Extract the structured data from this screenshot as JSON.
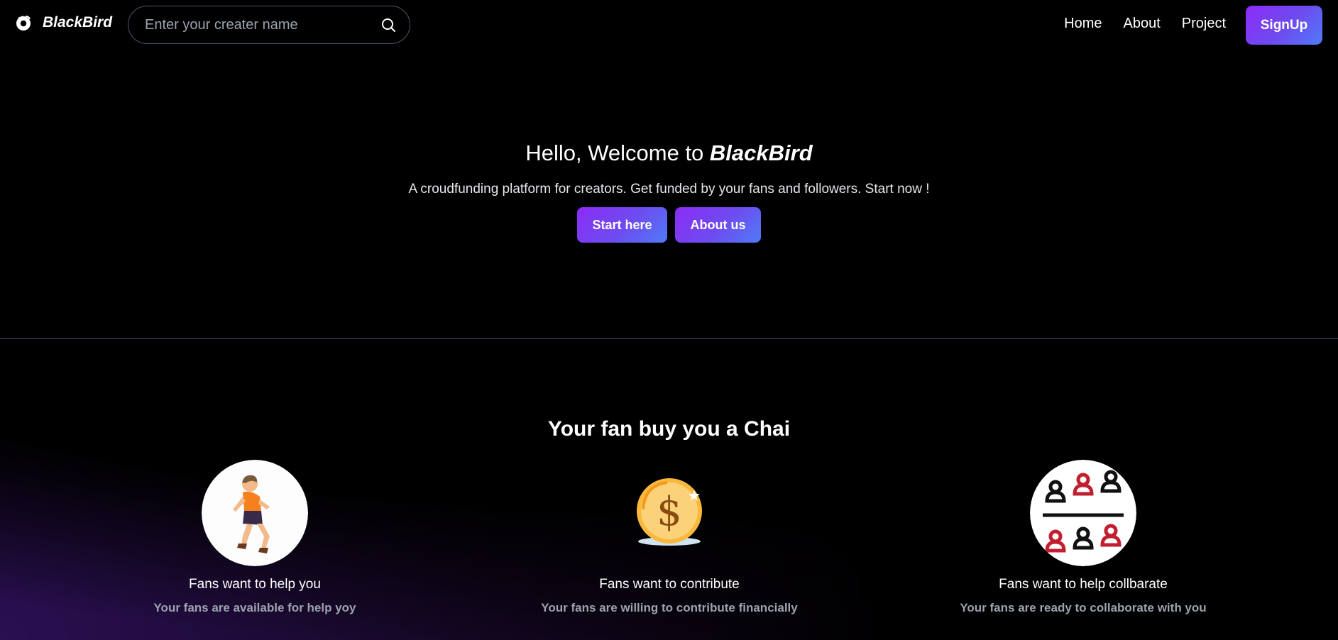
{
  "header": {
    "brand": "BlackBird",
    "search": {
      "placeholder": "Enter your creater name",
      "value": ""
    },
    "nav": [
      {
        "label": "Home"
      },
      {
        "label": "About"
      },
      {
        "label": "Project"
      }
    ],
    "signup_label": "SignUp"
  },
  "hero": {
    "title_prefix": "Hello, Welcome to ",
    "title_brand": "BlackBird",
    "subtitle": "A croudfunding platform for creators. Get funded by your fans and followers. Start now !",
    "start_label": "Start here",
    "about_label": "About us"
  },
  "features": {
    "title": "Your fan buy you a Chai",
    "items": [
      {
        "icon": "running-person-icon",
        "title": "Fans want to help you",
        "desc": "Your fans are available for help yoy"
      },
      {
        "icon": "coin-icon",
        "title": "Fans want to contribute",
        "desc": "Your fans are willing to contribute financially"
      },
      {
        "icon": "group-icon",
        "title": "Fans want to help collbarate",
        "desc": "Your fans are ready to collaborate with you"
      }
    ]
  },
  "colors": {
    "accent_start": "#8b2cf5",
    "accent_end": "#4f7cf7",
    "muted_text": "#9ca3af"
  }
}
